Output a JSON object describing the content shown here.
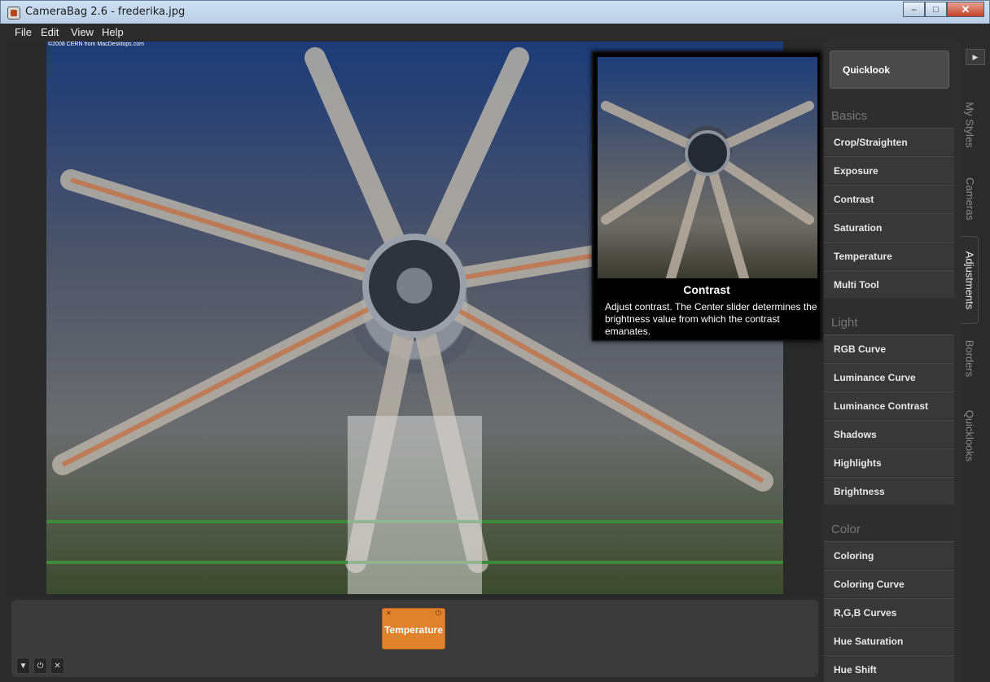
{
  "window": {
    "title": "CameraBag 2.6 - frederika.jpg"
  },
  "menu": [
    "File",
    "Edit",
    "View",
    "Help"
  ],
  "photo": {
    "credit": "©2008 CERN   from MacDesktops.com"
  },
  "tooltip": {
    "title": "Contrast",
    "description": "Adjust contrast. The Center slider determines the brightness value from which the contrast emanates."
  },
  "dock": {
    "chip_label": "Temperature"
  },
  "panel": {
    "quicklook": "Quicklook",
    "sections": [
      {
        "title": "Basics",
        "items": [
          "Crop/Straighten",
          "Exposure",
          "Contrast",
          "Saturation",
          "Temperature",
          "Multi Tool"
        ]
      },
      {
        "title": "Light",
        "items": [
          "RGB Curve",
          "Luminance Curve",
          "Luminance Contrast",
          "Shadows",
          "Highlights",
          "Brightness"
        ]
      },
      {
        "title": "Color",
        "items": [
          "Coloring",
          "Coloring Curve",
          "R,G,B Curves",
          "Hue Saturation",
          "Hue Shift"
        ]
      }
    ]
  },
  "tabs": [
    "My Styles",
    "Cameras",
    "Adjustments",
    "Borders",
    "Quicklooks"
  ],
  "active_tab": "Adjustments"
}
